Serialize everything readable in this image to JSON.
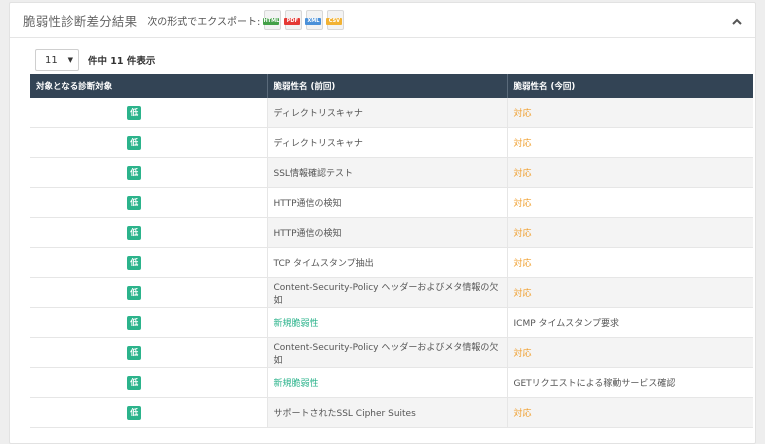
{
  "header": {
    "title": "脆弱性診断差分結果",
    "export_label": "次の形式でエクスポート:",
    "export_formats": [
      {
        "label": "HTML",
        "color": "#43a047"
      },
      {
        "label": "PDF",
        "color": "#e53935"
      },
      {
        "label": "XML",
        "color": "#4a90d9"
      },
      {
        "label": "CSV",
        "color": "#f2b233"
      }
    ],
    "collapse_icon": "chevron-up-icon"
  },
  "controls": {
    "page_size": "11",
    "count_text": "件中 11 件表示"
  },
  "table": {
    "columns": [
      "対象となる診断対象",
      "脆弱性名 (前回)",
      "脆弱性名 (今回)"
    ],
    "badge_color": "#2bb38b",
    "rows": [
      {
        "severity": "低",
        "previous": "ディレクトリスキャナ",
        "current": "対応"
      },
      {
        "severity": "低",
        "previous": "ディレクトリスキャナ",
        "current": "対応"
      },
      {
        "severity": "低",
        "previous": "SSL情報確認テスト",
        "current": "対応"
      },
      {
        "severity": "低",
        "previous": "HTTP通信の検知",
        "current": "対応"
      },
      {
        "severity": "低",
        "previous": "HTTP通信の検知",
        "current": "対応"
      },
      {
        "severity": "低",
        "previous": "TCP タイムスタンプ抽出",
        "current": "対応"
      },
      {
        "severity": "低",
        "previous": "Content-Security-Policy ヘッダーおよびメタ情報の欠如",
        "current": "対応"
      },
      {
        "severity": "低",
        "previous": "新規脆弱性",
        "current": "ICMP タイムスタンプ要求"
      },
      {
        "severity": "低",
        "previous": "Content-Security-Policy ヘッダーおよびメタ情報の欠如",
        "current": "対応"
      },
      {
        "severity": "低",
        "previous": "新規脆弱性",
        "current": "GETリクエストによる稼動サービス確認"
      },
      {
        "severity": "低",
        "previous": "サポートされたSSL Cipher Suites",
        "current": "対応"
      }
    ]
  }
}
